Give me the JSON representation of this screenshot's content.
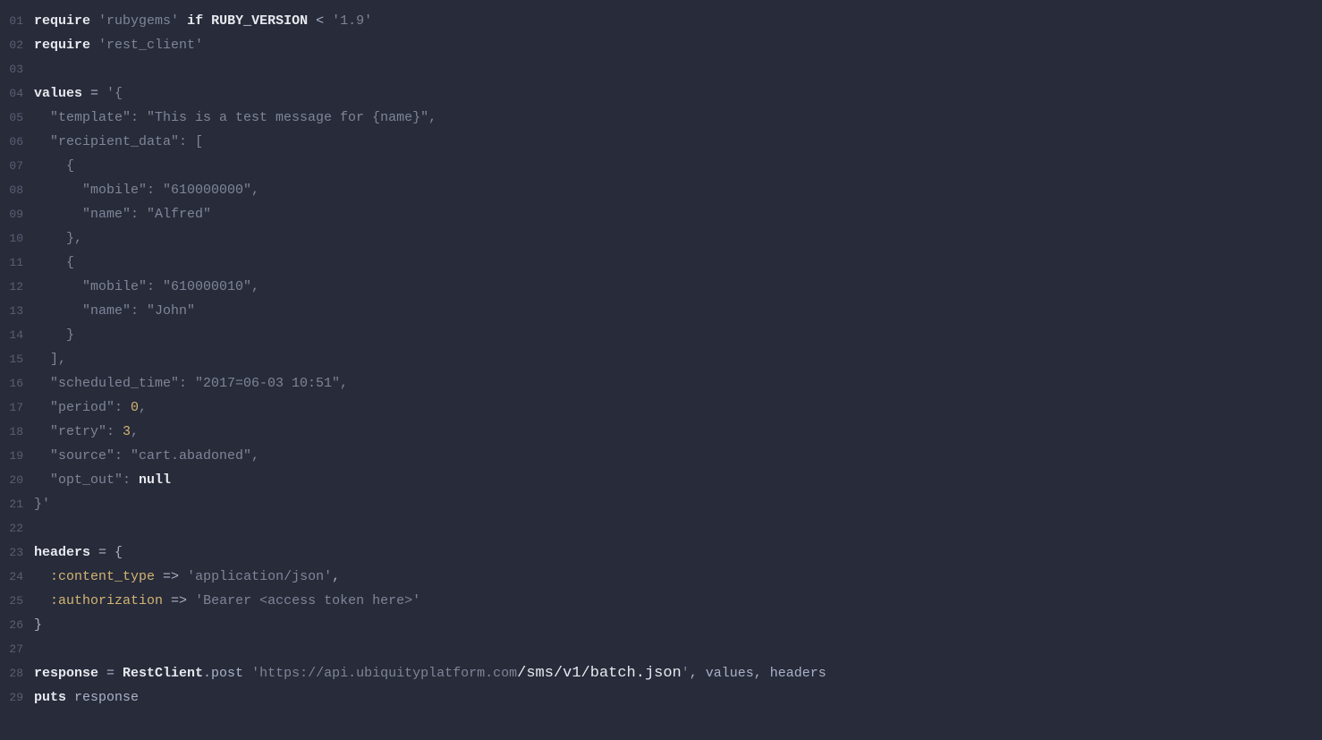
{
  "lines": [
    {
      "num": "01",
      "tokens": [
        {
          "c": "kw",
          "t": "require"
        },
        {
          "c": "op",
          "t": " "
        },
        {
          "c": "str",
          "t": "'rubygems'"
        },
        {
          "c": "op",
          "t": " "
        },
        {
          "c": "kw",
          "t": "if"
        },
        {
          "c": "op",
          "t": " "
        },
        {
          "c": "id",
          "t": "RUBY_VERSION"
        },
        {
          "c": "op",
          "t": " < "
        },
        {
          "c": "str",
          "t": "'1.9'"
        }
      ]
    },
    {
      "num": "02",
      "tokens": [
        {
          "c": "kw",
          "t": "require"
        },
        {
          "c": "op",
          "t": " "
        },
        {
          "c": "str",
          "t": "'rest_client'"
        }
      ]
    },
    {
      "num": "03",
      "tokens": []
    },
    {
      "num": "04",
      "tokens": [
        {
          "c": "id",
          "t": "values"
        },
        {
          "c": "op",
          "t": " = "
        },
        {
          "c": "str",
          "t": "'{"
        }
      ]
    },
    {
      "num": "05",
      "tokens": [
        {
          "c": "str",
          "t": "  \"template\": \"This is a test message for {name}\","
        }
      ]
    },
    {
      "num": "06",
      "tokens": [
        {
          "c": "str",
          "t": "  \"recipient_data\": ["
        }
      ]
    },
    {
      "num": "07",
      "tokens": [
        {
          "c": "str",
          "t": "    {"
        }
      ]
    },
    {
      "num": "08",
      "tokens": [
        {
          "c": "str",
          "t": "      \"mobile\": \"610000000\","
        }
      ]
    },
    {
      "num": "09",
      "tokens": [
        {
          "c": "str",
          "t": "      \"name\": \"Alfred\""
        }
      ]
    },
    {
      "num": "10",
      "tokens": [
        {
          "c": "str",
          "t": "    },"
        }
      ]
    },
    {
      "num": "11",
      "tokens": [
        {
          "c": "str",
          "t": "    {"
        }
      ]
    },
    {
      "num": "12",
      "tokens": [
        {
          "c": "str",
          "t": "      \"mobile\": \"610000010\","
        }
      ]
    },
    {
      "num": "13",
      "tokens": [
        {
          "c": "str",
          "t": "      \"name\": \"John\""
        }
      ]
    },
    {
      "num": "14",
      "tokens": [
        {
          "c": "str",
          "t": "    }"
        }
      ]
    },
    {
      "num": "15",
      "tokens": [
        {
          "c": "str",
          "t": "  ],"
        }
      ]
    },
    {
      "num": "16",
      "tokens": [
        {
          "c": "str",
          "t": "  \"scheduled_time\": \"2017=06-03 10:51\","
        }
      ]
    },
    {
      "num": "17",
      "tokens": [
        {
          "c": "str",
          "t": "  \"period\": "
        },
        {
          "c": "num",
          "t": "0"
        },
        {
          "c": "str",
          "t": ","
        }
      ]
    },
    {
      "num": "18",
      "tokens": [
        {
          "c": "str",
          "t": "  \"retry\": "
        },
        {
          "c": "num",
          "t": "3"
        },
        {
          "c": "str",
          "t": ","
        }
      ]
    },
    {
      "num": "19",
      "tokens": [
        {
          "c": "str",
          "t": "  \"source\": \"cart.abadoned\","
        }
      ]
    },
    {
      "num": "20",
      "tokens": [
        {
          "c": "str",
          "t": "  \"opt_out\": "
        },
        {
          "c": "nil",
          "t": "null"
        }
      ]
    },
    {
      "num": "21",
      "tokens": [
        {
          "c": "str",
          "t": "}'"
        }
      ]
    },
    {
      "num": "22",
      "tokens": []
    },
    {
      "num": "23",
      "tokens": [
        {
          "c": "id",
          "t": "headers"
        },
        {
          "c": "op",
          "t": " = {"
        }
      ]
    },
    {
      "num": "24",
      "tokens": [
        {
          "c": "op",
          "t": "  "
        },
        {
          "c": "sym",
          "t": ":content_type"
        },
        {
          "c": "op",
          "t": " => "
        },
        {
          "c": "str",
          "t": "'application/json'"
        },
        {
          "c": "op",
          "t": ","
        }
      ]
    },
    {
      "num": "25",
      "tokens": [
        {
          "c": "op",
          "t": "  "
        },
        {
          "c": "sym",
          "t": ":authorization"
        },
        {
          "c": "op",
          "t": " => "
        },
        {
          "c": "str",
          "t": "'Bearer <access token here>'"
        }
      ]
    },
    {
      "num": "26",
      "tokens": [
        {
          "c": "op",
          "t": "}"
        }
      ]
    },
    {
      "num": "27",
      "tokens": []
    },
    {
      "num": "28",
      "tokens": [
        {
          "c": "id",
          "t": "response"
        },
        {
          "c": "op",
          "t": " = "
        },
        {
          "c": "id",
          "t": "RestClient"
        },
        {
          "c": "op",
          "t": ".post "
        },
        {
          "c": "str",
          "t": "'https://api.ubiquityplatform.com"
        },
        {
          "c": "url-em",
          "t": "/sms/v1/batch.json"
        },
        {
          "c": "str",
          "t": "'"
        },
        {
          "c": "op",
          "t": ", values, headers"
        }
      ]
    },
    {
      "num": "29",
      "tokens": [
        {
          "c": "kw",
          "t": "puts"
        },
        {
          "c": "op",
          "t": " response"
        }
      ]
    }
  ]
}
